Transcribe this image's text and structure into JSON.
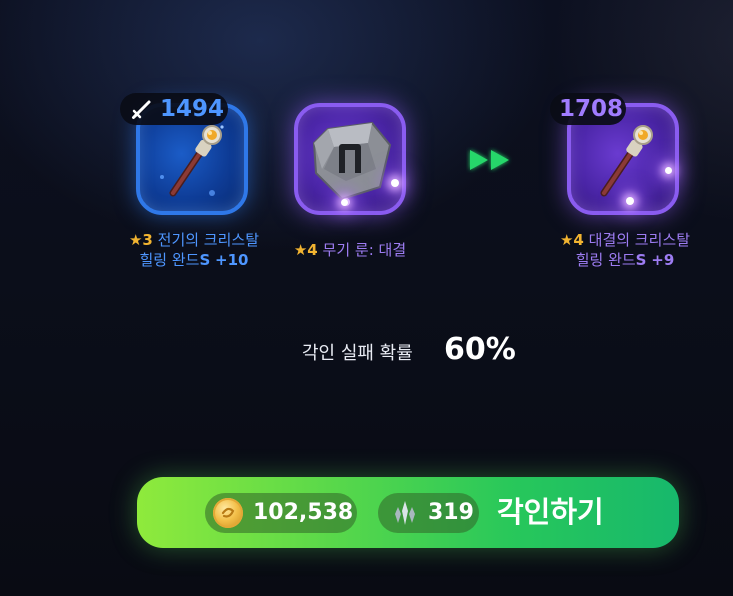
{
  "source_item": {
    "power": "1494",
    "stars": "★3",
    "name_line1": "전기의 크리스탈",
    "name_line2": "힐링 완드",
    "grade": "S",
    "enhance": "+10"
  },
  "rune": {
    "stars": "★4",
    "name": "무기 룬: 대결"
  },
  "result_item": {
    "power": "1708",
    "stars": "★4",
    "name_line1": "대결의 크리스탈",
    "name_line2": "힐링 완드",
    "grade": "S",
    "enhance": "+9"
  },
  "fail_chance": {
    "label": "각인 실패 확률",
    "value": "60%"
  },
  "engrave_button": {
    "gold_cost": "102,538",
    "gem_cost": "319",
    "label": "각인하기"
  },
  "icons": [
    "sword-icon",
    "healing-wand-icon",
    "rune-stone-icon",
    "forward-arrows-icon",
    "gold-coin-icon",
    "crystal-gem-icon"
  ],
  "colors": {
    "blue_accent": "#4e96ff",
    "purple_accent": "#9d7cf2",
    "star": "#f2b431",
    "button_start": "#8fea3c",
    "button_end": "#17b86c"
  }
}
